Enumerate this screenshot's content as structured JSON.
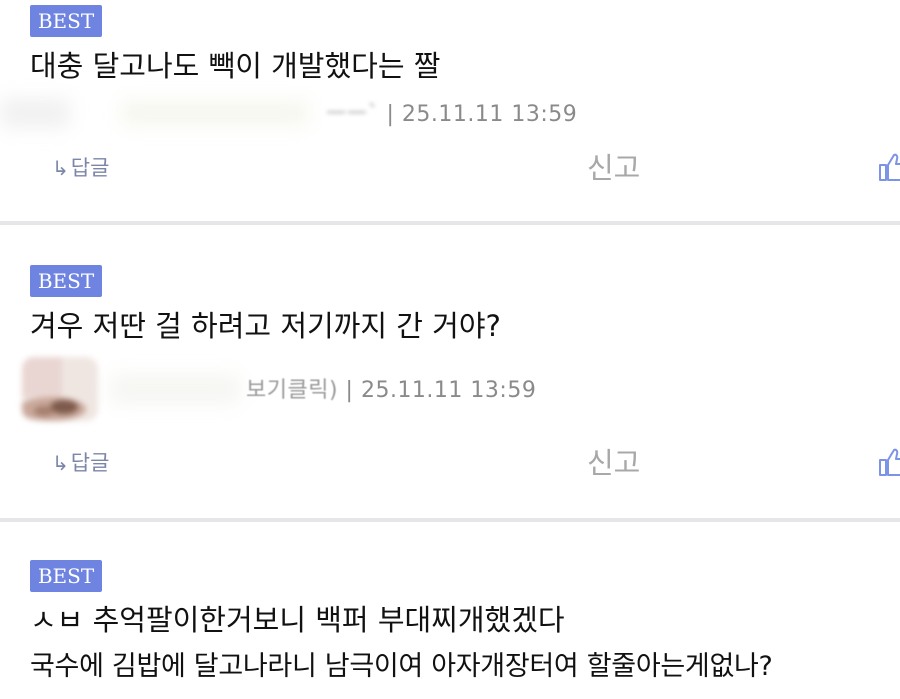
{
  "comments": [
    {
      "badge": "BEST",
      "lines": [
        "대충 달고나도 빽이 개발했다는 짤"
      ],
      "author": "ㅡㅡ`",
      "meta": "| 25.11.11 13:59",
      "reply_label": "답글",
      "report_label": "신고"
    },
    {
      "badge": "BEST",
      "lines": [
        "겨우 저딴 걸 하려고 저기까지 간 거야?"
      ],
      "author": "보기클릭)",
      "meta": "| 25.11.11 13:59",
      "reply_label": "답글",
      "report_label": "신고"
    },
    {
      "badge": "BEST",
      "lines": [
        "ㅅㅂ 추억팔이한거보니 백퍼 부대찌개했겠다",
        "국수에 김밥에 달고나라니 남극이여 아자개장터여 할줄아는게없나?"
      ]
    }
  ],
  "icons": {
    "reply": "reply-arrow-icon",
    "like": "thumbs-up-icon"
  },
  "colors": {
    "badge_bg": "#6f84e0",
    "reply_text": "#7c86a8",
    "report_text": "#a8a8a8",
    "meta_text": "#8a8a8a",
    "like_icon": "#7c94e6"
  }
}
